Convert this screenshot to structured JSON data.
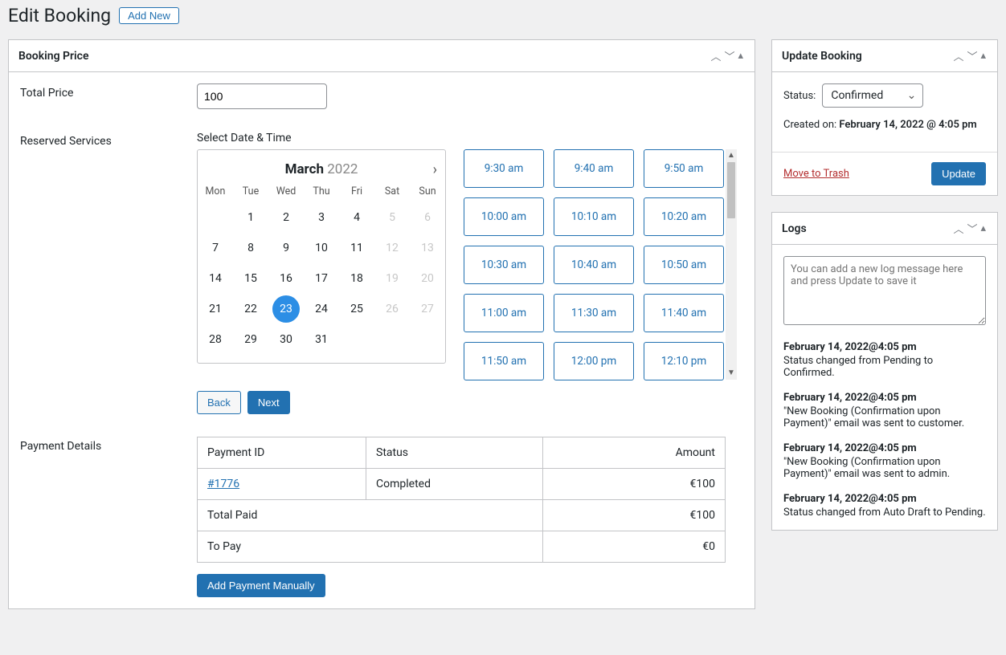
{
  "page": {
    "title": "Edit Booking",
    "add_new": "Add New"
  },
  "booking_price": {
    "panel_title": "Booking Price",
    "total_price_label": "Total Price",
    "total_price_value": "100",
    "reserved_services_label": "Reserved Services",
    "select_datetime_label": "Select Date & Time",
    "back_label": "Back",
    "next_label": "Next",
    "payment_details_label": "Payment Details",
    "add_payment_label": "Add Payment Manually"
  },
  "calendar": {
    "month": "March",
    "year": "2022",
    "dow": [
      "Mon",
      "Tue",
      "Wed",
      "Thu",
      "Fri",
      "Sat",
      "Sun"
    ],
    "weeks": [
      [
        {
          "d": "",
          "dis": true
        },
        {
          "d": "1"
        },
        {
          "d": "2"
        },
        {
          "d": "3"
        },
        {
          "d": "4"
        },
        {
          "d": "5",
          "dis": true
        },
        {
          "d": "6",
          "dis": true
        }
      ],
      [
        {
          "d": "7"
        },
        {
          "d": "8"
        },
        {
          "d": "9"
        },
        {
          "d": "10"
        },
        {
          "d": "11"
        },
        {
          "d": "12",
          "dis": true
        },
        {
          "d": "13",
          "dis": true
        }
      ],
      [
        {
          "d": "14"
        },
        {
          "d": "15"
        },
        {
          "d": "16"
        },
        {
          "d": "17"
        },
        {
          "d": "18"
        },
        {
          "d": "19",
          "dis": true
        },
        {
          "d": "20",
          "dis": true
        }
      ],
      [
        {
          "d": "21"
        },
        {
          "d": "22"
        },
        {
          "d": "23",
          "sel": true
        },
        {
          "d": "24"
        },
        {
          "d": "25"
        },
        {
          "d": "26",
          "dis": true
        },
        {
          "d": "27",
          "dis": true
        }
      ],
      [
        {
          "d": "28"
        },
        {
          "d": "29"
        },
        {
          "d": "30"
        },
        {
          "d": "31"
        },
        {
          "d": "",
          "dis": true
        },
        {
          "d": "",
          "dis": true
        },
        {
          "d": "",
          "dis": true
        }
      ]
    ]
  },
  "timeslots": [
    "9:30 am",
    "9:40 am",
    "9:50 am",
    "10:00 am",
    "10:10 am",
    "10:20 am",
    "10:30 am",
    "10:40 am",
    "10:50 am",
    "11:00 am",
    "11:30 am",
    "11:40 am",
    "11:50 am",
    "12:00 pm",
    "12:10 pm"
  ],
  "payment_table": {
    "headers": {
      "id": "Payment ID",
      "status": "Status",
      "amount": "Amount"
    },
    "rows": [
      {
        "id": "#1776",
        "status": "Completed",
        "amount": "€100",
        "link": true
      }
    ],
    "total_paid_label": "Total Paid",
    "total_paid_value": "€100",
    "to_pay_label": "To Pay",
    "to_pay_value": "€0"
  },
  "update_booking": {
    "panel_title": "Update Booking",
    "status_label": "Status:",
    "status_value": "Confirmed",
    "created_on_label": "Created on:",
    "created_on_value": "February 14, 2022 @ 4:05 pm",
    "trash_label": "Move to Trash",
    "update_label": "Update"
  },
  "logs": {
    "panel_title": "Logs",
    "placeholder": "You can add a new log message here and press Update to save it",
    "entries": [
      {
        "t": "February 14, 2022@4:05 pm",
        "m": "Status changed from Pending to Confirmed."
      },
      {
        "t": "February 14, 2022@4:05 pm",
        "m": "\"New Booking (Confirmation upon Payment)\" email was sent to customer."
      },
      {
        "t": "February 14, 2022@4:05 pm",
        "m": "\"New Booking (Confirmation upon Payment)\" email was sent to admin."
      },
      {
        "t": "February 14, 2022@4:05 pm",
        "m": "Status changed from Auto Draft to Pending."
      }
    ]
  }
}
